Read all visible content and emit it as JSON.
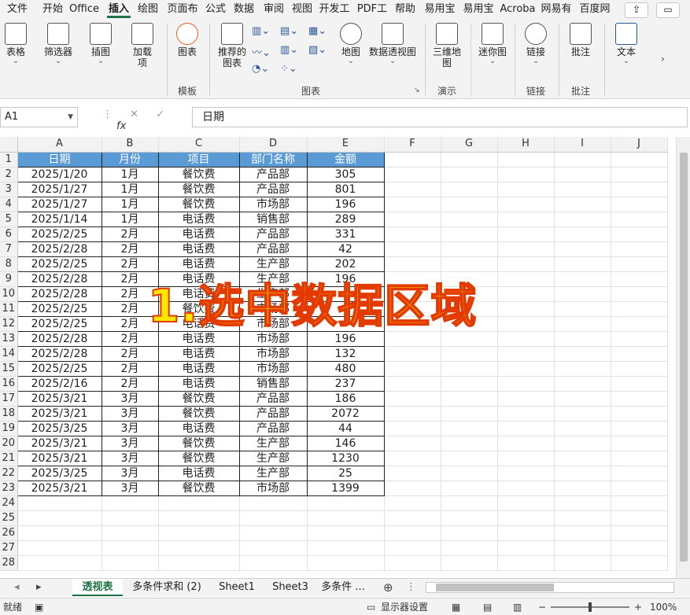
{
  "ribbon_tabs": [
    {
      "label": "文件"
    },
    {
      "label": "开始"
    },
    {
      "label": "Office"
    },
    {
      "label": "插入",
      "active": true
    },
    {
      "label": "绘图"
    },
    {
      "label": "页面布"
    },
    {
      "label": "公式"
    },
    {
      "label": "数据"
    },
    {
      "label": "审阅"
    },
    {
      "label": "视图"
    },
    {
      "label": "开发工"
    },
    {
      "label": "PDF工"
    },
    {
      "label": "帮助"
    },
    {
      "label": "易用宝"
    },
    {
      "label": "易用宝"
    },
    {
      "label": "Acroba"
    },
    {
      "label": "网易有"
    },
    {
      "label": "百度网"
    }
  ],
  "ribbon": {
    "table": "表格",
    "slicer": "筛选器",
    "illustrations": "插图",
    "addins_1": "加载",
    "addins_2": "项",
    "icons_chart": "图表",
    "recommended_1": "推荐的",
    "recommended_2": "图表",
    "map": "地图",
    "pivot_chart": "数据透视图",
    "map3d_1": "三维地",
    "map3d_2": "图",
    "sparklines": "迷你图",
    "link": "链接",
    "comment": "批注",
    "text": "文本",
    "groups": {
      "models": "模板",
      "charts": "图表",
      "tours": "演示",
      "links": "链接",
      "comments": "批注"
    }
  },
  "formula_bar": {
    "name_box": "A1",
    "content": "日期"
  },
  "columns": [
    "A",
    "B",
    "C",
    "D",
    "E",
    "F",
    "G",
    "H",
    "I",
    "J"
  ],
  "headers": [
    "日期",
    "月份",
    "项目",
    "部门名称",
    "金额"
  ],
  "rows": [
    [
      "2025/1/20",
      "1月",
      "餐饮费",
      "产品部",
      "305"
    ],
    [
      "2025/1/27",
      "1月",
      "餐饮费",
      "产品部",
      "801"
    ],
    [
      "2025/1/27",
      "1月",
      "餐饮费",
      "市场部",
      "196"
    ],
    [
      "2025/1/14",
      "1月",
      "电话费",
      "销售部",
      "289"
    ],
    [
      "2025/2/25",
      "2月",
      "电话费",
      "产品部",
      "331"
    ],
    [
      "2025/2/28",
      "2月",
      "电话费",
      "产品部",
      "42"
    ],
    [
      "2025/2/25",
      "2月",
      "电话费",
      "生产部",
      "202"
    ],
    [
      "2025/2/28",
      "2月",
      "电话费",
      "生产部",
      "196"
    ],
    [
      "2025/2/28",
      "2月",
      "电话费",
      "生产部",
      ""
    ],
    [
      "2025/2/25",
      "2月",
      "餐饮费",
      "市场部",
      ""
    ],
    [
      "2025/2/25",
      "2月",
      "电话费",
      "市场部",
      ""
    ],
    [
      "2025/2/28",
      "2月",
      "电话费",
      "市场部",
      "196"
    ],
    [
      "2025/2/28",
      "2月",
      "电话费",
      "市场部",
      "132"
    ],
    [
      "2025/2/25",
      "2月",
      "电话费",
      "市场部",
      "480"
    ],
    [
      "2025/2/16",
      "2月",
      "电话费",
      "销售部",
      "237"
    ],
    [
      "2025/3/21",
      "3月",
      "餐饮费",
      "产品部",
      "186"
    ],
    [
      "2025/3/21",
      "3月",
      "餐饮费",
      "产品部",
      "2072"
    ],
    [
      "2025/3/25",
      "3月",
      "电话费",
      "产品部",
      "44"
    ],
    [
      "2025/3/21",
      "3月",
      "餐饮费",
      "生产部",
      "146"
    ],
    [
      "2025/3/21",
      "3月",
      "餐饮费",
      "生产部",
      "1230"
    ],
    [
      "2025/3/25",
      "3月",
      "电话费",
      "生产部",
      "25"
    ],
    [
      "2025/3/21",
      "3月",
      "餐饮费",
      "市场部",
      "1399"
    ]
  ],
  "empty_rows": 5,
  "overlay_text": "1.选中数据区域",
  "sheet_tabs": [
    {
      "label": "透视表",
      "active": true
    },
    {
      "label": "多条件求和 (2)"
    },
    {
      "label": "Sheet1"
    },
    {
      "label": "Sheet3"
    },
    {
      "label": "多条件 ..."
    }
  ],
  "status": {
    "ready": "就绪",
    "display_settings": "显示器设置",
    "zoom": "100%"
  },
  "colors": {
    "header_fill": "#5b9bd5",
    "accent": "#1e7145",
    "overlay_text": "#ffe600",
    "overlay_stroke": "#e23a00"
  }
}
